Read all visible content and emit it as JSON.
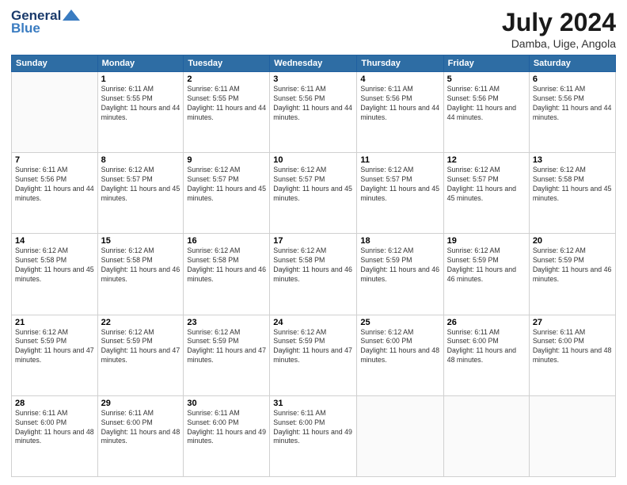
{
  "header": {
    "logo_line1": "General",
    "logo_line2": "Blue",
    "title": "July 2024",
    "subtitle": "Damba, Uige, Angola"
  },
  "columns": [
    "Sunday",
    "Monday",
    "Tuesday",
    "Wednesday",
    "Thursday",
    "Friday",
    "Saturday"
  ],
  "weeks": [
    [
      {
        "day": "",
        "sunrise": "",
        "sunset": "",
        "daylight": ""
      },
      {
        "day": "1",
        "sunrise": "Sunrise: 6:11 AM",
        "sunset": "Sunset: 5:55 PM",
        "daylight": "Daylight: 11 hours and 44 minutes."
      },
      {
        "day": "2",
        "sunrise": "Sunrise: 6:11 AM",
        "sunset": "Sunset: 5:55 PM",
        "daylight": "Daylight: 11 hours and 44 minutes."
      },
      {
        "day": "3",
        "sunrise": "Sunrise: 6:11 AM",
        "sunset": "Sunset: 5:56 PM",
        "daylight": "Daylight: 11 hours and 44 minutes."
      },
      {
        "day": "4",
        "sunrise": "Sunrise: 6:11 AM",
        "sunset": "Sunset: 5:56 PM",
        "daylight": "Daylight: 11 hours and 44 minutes."
      },
      {
        "day": "5",
        "sunrise": "Sunrise: 6:11 AM",
        "sunset": "Sunset: 5:56 PM",
        "daylight": "Daylight: 11 hours and 44 minutes."
      },
      {
        "day": "6",
        "sunrise": "Sunrise: 6:11 AM",
        "sunset": "Sunset: 5:56 PM",
        "daylight": "Daylight: 11 hours and 44 minutes."
      }
    ],
    [
      {
        "day": "7",
        "sunrise": "Sunrise: 6:11 AM",
        "sunset": "Sunset: 5:56 PM",
        "daylight": "Daylight: 11 hours and 44 minutes."
      },
      {
        "day": "8",
        "sunrise": "Sunrise: 6:12 AM",
        "sunset": "Sunset: 5:57 PM",
        "daylight": "Daylight: 11 hours and 45 minutes."
      },
      {
        "day": "9",
        "sunrise": "Sunrise: 6:12 AM",
        "sunset": "Sunset: 5:57 PM",
        "daylight": "Daylight: 11 hours and 45 minutes."
      },
      {
        "day": "10",
        "sunrise": "Sunrise: 6:12 AM",
        "sunset": "Sunset: 5:57 PM",
        "daylight": "Daylight: 11 hours and 45 minutes."
      },
      {
        "day": "11",
        "sunrise": "Sunrise: 6:12 AM",
        "sunset": "Sunset: 5:57 PM",
        "daylight": "Daylight: 11 hours and 45 minutes."
      },
      {
        "day": "12",
        "sunrise": "Sunrise: 6:12 AM",
        "sunset": "Sunset: 5:57 PM",
        "daylight": "Daylight: 11 hours and 45 minutes."
      },
      {
        "day": "13",
        "sunrise": "Sunrise: 6:12 AM",
        "sunset": "Sunset: 5:58 PM",
        "daylight": "Daylight: 11 hours and 45 minutes."
      }
    ],
    [
      {
        "day": "14",
        "sunrise": "Sunrise: 6:12 AM",
        "sunset": "Sunset: 5:58 PM",
        "daylight": "Daylight: 11 hours and 45 minutes."
      },
      {
        "day": "15",
        "sunrise": "Sunrise: 6:12 AM",
        "sunset": "Sunset: 5:58 PM",
        "daylight": "Daylight: 11 hours and 46 minutes."
      },
      {
        "day": "16",
        "sunrise": "Sunrise: 6:12 AM",
        "sunset": "Sunset: 5:58 PM",
        "daylight": "Daylight: 11 hours and 46 minutes."
      },
      {
        "day": "17",
        "sunrise": "Sunrise: 6:12 AM",
        "sunset": "Sunset: 5:58 PM",
        "daylight": "Daylight: 11 hours and 46 minutes."
      },
      {
        "day": "18",
        "sunrise": "Sunrise: 6:12 AM",
        "sunset": "Sunset: 5:59 PM",
        "daylight": "Daylight: 11 hours and 46 minutes."
      },
      {
        "day": "19",
        "sunrise": "Sunrise: 6:12 AM",
        "sunset": "Sunset: 5:59 PM",
        "daylight": "Daylight: 11 hours and 46 minutes."
      },
      {
        "day": "20",
        "sunrise": "Sunrise: 6:12 AM",
        "sunset": "Sunset: 5:59 PM",
        "daylight": "Daylight: 11 hours and 46 minutes."
      }
    ],
    [
      {
        "day": "21",
        "sunrise": "Sunrise: 6:12 AM",
        "sunset": "Sunset: 5:59 PM",
        "daylight": "Daylight: 11 hours and 47 minutes."
      },
      {
        "day": "22",
        "sunrise": "Sunrise: 6:12 AM",
        "sunset": "Sunset: 5:59 PM",
        "daylight": "Daylight: 11 hours and 47 minutes."
      },
      {
        "day": "23",
        "sunrise": "Sunrise: 6:12 AM",
        "sunset": "Sunset: 5:59 PM",
        "daylight": "Daylight: 11 hours and 47 minutes."
      },
      {
        "day": "24",
        "sunrise": "Sunrise: 6:12 AM",
        "sunset": "Sunset: 5:59 PM",
        "daylight": "Daylight: 11 hours and 47 minutes."
      },
      {
        "day": "25",
        "sunrise": "Sunrise: 6:12 AM",
        "sunset": "Sunset: 6:00 PM",
        "daylight": "Daylight: 11 hours and 48 minutes."
      },
      {
        "day": "26",
        "sunrise": "Sunrise: 6:11 AM",
        "sunset": "Sunset: 6:00 PM",
        "daylight": "Daylight: 11 hours and 48 minutes."
      },
      {
        "day": "27",
        "sunrise": "Sunrise: 6:11 AM",
        "sunset": "Sunset: 6:00 PM",
        "daylight": "Daylight: 11 hours and 48 minutes."
      }
    ],
    [
      {
        "day": "28",
        "sunrise": "Sunrise: 6:11 AM",
        "sunset": "Sunset: 6:00 PM",
        "daylight": "Daylight: 11 hours and 48 minutes."
      },
      {
        "day": "29",
        "sunrise": "Sunrise: 6:11 AM",
        "sunset": "Sunset: 6:00 PM",
        "daylight": "Daylight: 11 hours and 48 minutes."
      },
      {
        "day": "30",
        "sunrise": "Sunrise: 6:11 AM",
        "sunset": "Sunset: 6:00 PM",
        "daylight": "Daylight: 11 hours and 49 minutes."
      },
      {
        "day": "31",
        "sunrise": "Sunrise: 6:11 AM",
        "sunset": "Sunset: 6:00 PM",
        "daylight": "Daylight: 11 hours and 49 minutes."
      },
      {
        "day": "",
        "sunrise": "",
        "sunset": "",
        "daylight": ""
      },
      {
        "day": "",
        "sunrise": "",
        "sunset": "",
        "daylight": ""
      },
      {
        "day": "",
        "sunrise": "",
        "sunset": "",
        "daylight": ""
      }
    ]
  ]
}
